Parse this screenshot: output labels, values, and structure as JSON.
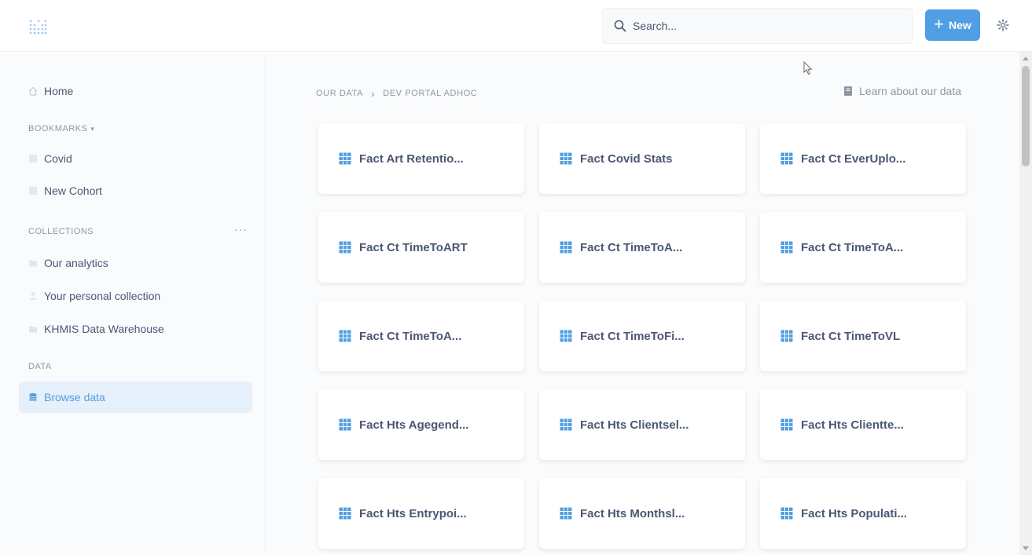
{
  "header": {
    "logo_icon": "metabase-logo-icon",
    "search_placeholder": "Search...",
    "new_label": "New",
    "new_icon": "plus-icon",
    "settings_icon": "gear-icon",
    "accent_color": "#509ee3"
  },
  "sidebar": {
    "home_label": "Home",
    "bookmarks_title": "BOOKMARKS",
    "bookmarks": [
      {
        "label": "Covid"
      },
      {
        "label": "New Cohort"
      }
    ],
    "collections_title": "COLLECTIONS",
    "collections_more": "···",
    "collections": [
      {
        "label": "Our analytics",
        "icon": "folder-icon"
      },
      {
        "label": "Your personal collection",
        "icon": "person-icon"
      },
      {
        "label": "KHMIS Data Warehouse",
        "icon": "folder-icon"
      }
    ],
    "data_title": "DATA",
    "browse_label": "Browse data"
  },
  "main": {
    "breadcrumb": [
      "OUR DATA",
      "DEV PORTAL ADHOC"
    ],
    "learn_label": "Learn about our data",
    "tables": [
      "Fact Art Retentio...",
      "Fact Covid Stats",
      "Fact Ct EverUplo...",
      "Fact Ct TimeToART",
      "Fact Ct TimeToA...",
      "Fact Ct TimeToA...",
      "Fact Ct TimeToA...",
      "Fact Ct TimeToFi...",
      "Fact Ct TimeToVL",
      "Fact Hts Agegend...",
      "Fact Hts Clientsel...",
      "Fact Hts Clientte...",
      "Fact Hts Entrypoi...",
      "Fact Hts Monthsl...",
      "Fact Hts Populati..."
    ]
  }
}
